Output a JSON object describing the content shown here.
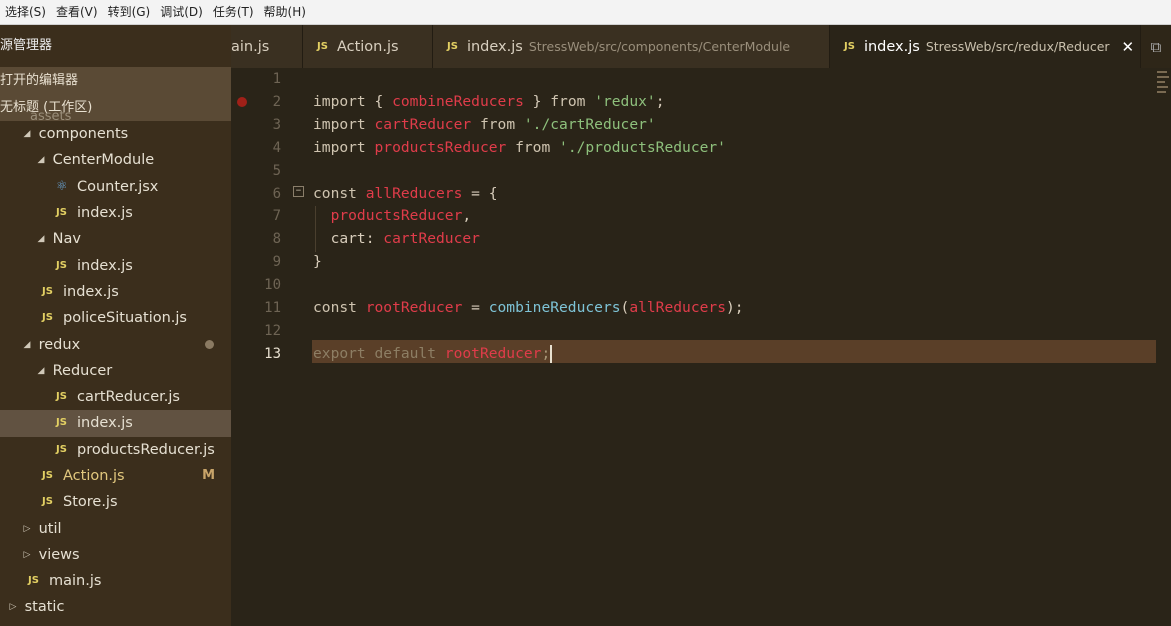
{
  "menu": [
    "选择(S)",
    "查看(V)",
    "转到(G)",
    "调试(D)",
    "任务(T)",
    "帮助(H)"
  ],
  "sidebar": {
    "title": "源管理器",
    "open_editors": "打开的编辑器",
    "workspace": "无标题 (工作区)",
    "peek_folder": "assets",
    "tree": [
      {
        "label": "components",
        "indent": 1,
        "type": "folder-open"
      },
      {
        "label": "CenterModule",
        "indent": 2,
        "type": "folder-open"
      },
      {
        "label": "Counter.jsx",
        "indent": 3,
        "type": "react"
      },
      {
        "label": "index.js",
        "indent": 3,
        "type": "js"
      },
      {
        "label": "Nav",
        "indent": 2,
        "type": "folder-open"
      },
      {
        "label": "index.js",
        "indent": 3,
        "type": "js"
      },
      {
        "label": "index.js",
        "indent": 2,
        "type": "js"
      },
      {
        "label": "policeSituation.js",
        "indent": 2,
        "type": "js"
      },
      {
        "label": "redux",
        "indent": 1,
        "type": "folder-open",
        "dot": true
      },
      {
        "label": "Reducer",
        "indent": 2,
        "type": "folder-open"
      },
      {
        "label": "cartReducer.js",
        "indent": 3,
        "type": "js"
      },
      {
        "label": "index.js",
        "indent": 3,
        "type": "js",
        "selected": true
      },
      {
        "label": "productsReducer.js",
        "indent": 3,
        "type": "js"
      },
      {
        "label": "Action.js",
        "indent": 2,
        "type": "js",
        "modified": "M"
      },
      {
        "label": "Store.js",
        "indent": 2,
        "type": "js"
      },
      {
        "label": "util",
        "indent": 1,
        "type": "folder-closed"
      },
      {
        "label": "views",
        "indent": 1,
        "type": "folder-closed"
      },
      {
        "label": "main.js",
        "indent": 1,
        "type": "js"
      },
      {
        "label": "static",
        "indent": 0,
        "type": "folder-closed"
      }
    ]
  },
  "tabs": [
    {
      "label": "ain.js",
      "js": false,
      "desc": ""
    },
    {
      "label": "Action.js",
      "js": true,
      "desc": ""
    },
    {
      "label": "index.js",
      "js": true,
      "desc": "StressWeb/src/components/CenterModule"
    },
    {
      "label": "index.js",
      "js": true,
      "desc": "StressWeb/src/redux/Reducer",
      "active": true
    }
  ],
  "js_badge": "JS",
  "close_glyph": "✕",
  "editor": {
    "current_line": 13,
    "lines": [
      {
        "n": "1",
        "tokens": []
      },
      {
        "n": "2",
        "tokens": [
          [
            "kw",
            "import "
          ],
          [
            "punc",
            "{ "
          ],
          [
            "id",
            "combineReducers"
          ],
          [
            "punc",
            " } "
          ],
          [
            "kw",
            "from "
          ],
          [
            "str",
            "'redux'"
          ],
          [
            "punc",
            ";"
          ]
        ]
      },
      {
        "n": "3",
        "tokens": [
          [
            "kw",
            "import "
          ],
          [
            "id",
            "cartReducer"
          ],
          [
            "kw",
            " from "
          ],
          [
            "str",
            "'./cartReducer'"
          ]
        ]
      },
      {
        "n": "4",
        "tokens": [
          [
            "kw",
            "import "
          ],
          [
            "id",
            "productsReducer"
          ],
          [
            "kw",
            " from "
          ],
          [
            "str",
            "'./productsReducer'"
          ]
        ]
      },
      {
        "n": "5",
        "tokens": []
      },
      {
        "n": "6",
        "tokens": [
          [
            "kw",
            "const "
          ],
          [
            "id",
            "allReducers"
          ],
          [
            "punc",
            " = {"
          ]
        ]
      },
      {
        "n": "7",
        "tokens": [
          [
            "punc",
            "  "
          ],
          [
            "id",
            "productsReducer"
          ],
          [
            "punc",
            ","
          ]
        ]
      },
      {
        "n": "8",
        "tokens": [
          [
            "punc",
            "  cart: "
          ],
          [
            "id",
            "cartReducer"
          ]
        ]
      },
      {
        "n": "9",
        "tokens": [
          [
            "punc",
            "}"
          ]
        ]
      },
      {
        "n": "10",
        "tokens": []
      },
      {
        "n": "11",
        "tokens": [
          [
            "kw",
            "const "
          ],
          [
            "id",
            "rootReducer"
          ],
          [
            "punc",
            " = "
          ],
          [
            "fn",
            "combineReducers"
          ],
          [
            "punc",
            "("
          ],
          [
            "id",
            "allReducers"
          ],
          [
            "punc",
            ");"
          ]
        ]
      },
      {
        "n": "12",
        "tokens": []
      },
      {
        "n": "13",
        "tokens": [
          [
            "kw",
            "export default "
          ],
          [
            "id",
            "rootReducer"
          ],
          [
            "punc",
            ";"
          ]
        ]
      }
    ]
  }
}
